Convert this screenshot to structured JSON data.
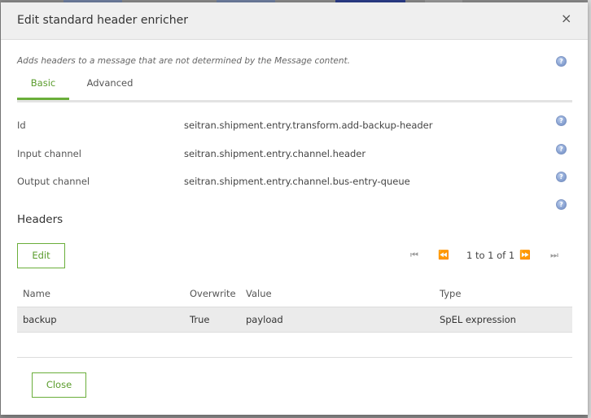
{
  "dialog": {
    "title": "Edit standard header enricher",
    "close_glyph": "×",
    "description": "Adds headers to a message that are not determined by the Message content.",
    "help_glyph": "?"
  },
  "tabs": [
    {
      "label": "Basic",
      "active": true
    },
    {
      "label": "Advanced",
      "active": false
    }
  ],
  "fields": {
    "id": {
      "label": "Id",
      "value": "seitran.shipment.entry.transform.add-backup-header"
    },
    "input_channel": {
      "label": "Input channel",
      "value": "seitran.shipment.entry.channel.header"
    },
    "output_channel": {
      "label": "Output channel",
      "value": "seitran.shipment.entry.channel.bus-entry-queue"
    }
  },
  "headers": {
    "title": "Headers",
    "edit_label": "Edit",
    "pager": {
      "first": "⏮",
      "prev": "⏪",
      "info": "1 to 1 of 1",
      "next": "⏩",
      "last": "⏭"
    },
    "columns": [
      "Name",
      "Overwrite",
      "Value",
      "Type"
    ],
    "rows": [
      {
        "name": "backup",
        "overwrite": "True",
        "value": "payload",
        "type": "SpEL expression"
      }
    ]
  },
  "footer": {
    "close_label": "Close"
  },
  "colors": {
    "accent": "#6aae3a",
    "header_bg": "#efefef",
    "row_bg": "#ebebeb"
  }
}
